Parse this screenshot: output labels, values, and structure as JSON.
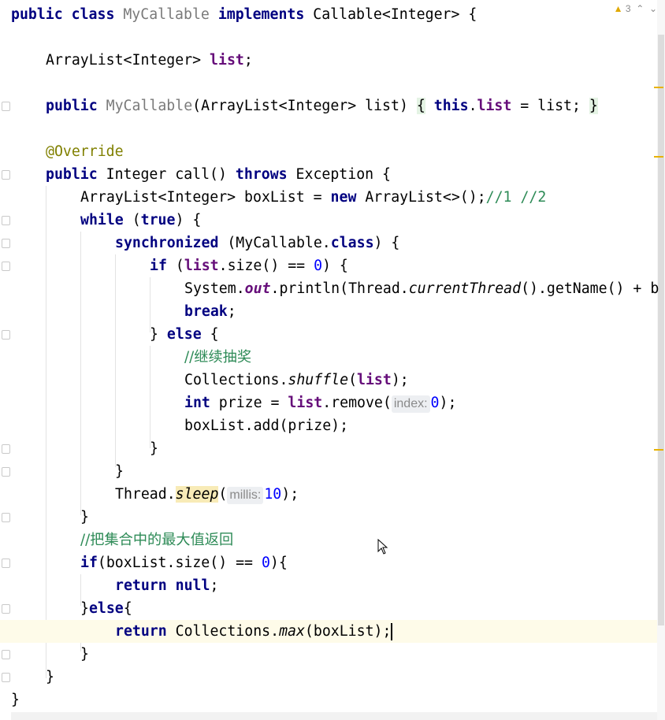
{
  "editor": {
    "warning_count": "3",
    "lines": [
      {
        "id": "l1"
      },
      {
        "id": "l2"
      }
    ],
    "code": {
      "class_decl": {
        "kw1": "public",
        "kw2": "class",
        "name": "MyCallable",
        "kw3": "implements",
        "rest": "Callable<Integer> {"
      },
      "field_decl": {
        "type": "ArrayList<Integer> ",
        "name": "list",
        ";": ";"
      },
      "ctor": {
        "kw": "public",
        "name": "MyCallable",
        "params": "(ArrayList<Integer> list) ",
        "open": "{",
        "kw2": "this",
        "dot": ".",
        "field": "list",
        "rest": " = list; ",
        "close": "}"
      },
      "annotation": "@Override",
      "method": {
        "kw1": "public",
        "mid1": " Integer call() ",
        "kw2": "throws",
        "rest": " Exception {"
      },
      "box_decl": {
        "pre": "ArrayList<Integer> boxList = ",
        "kw": "new",
        "post": " ArrayList<>();",
        "comment": "//1 //2"
      },
      "while_line": {
        "kw": "while",
        "mid": " (",
        "kw2": "true",
        "rest": ") {"
      },
      "sync_line": {
        "kw": "synchronized",
        "mid": " (MyCallable.",
        "kw2": "class",
        "rest": ") {"
      },
      "if_line": {
        "kw": "if",
        "pre": " (",
        "field": "list",
        "mid": ".size() == ",
        "num": "0",
        "rest": ") {"
      },
      "println_line": {
        "pre": "System.",
        "out": "out",
        "mid": ".println(Thread.",
        "cur": "currentThread",
        "rest": "().getName() + b"
      },
      "break_line": {
        "kw": "break",
        "rest": ";"
      },
      "else_line": {
        "pre": "} ",
        "kw": "else",
        "rest": " {"
      },
      "comment_lottery": "//继续抽奖",
      "shuffle_line": {
        "pre": "Collections.",
        "m": "shuffle",
        "open": "(",
        "field": "list",
        "rest": ");"
      },
      "remove_line": {
        "kw": "int",
        "pre": " prize = ",
        "field": "list",
        "mid": ".remove(",
        "hint": "index:",
        "num": "0",
        "rest": ");"
      },
      "add_line": "boxList.add(prize);",
      "close_if": "}",
      "close_sync": "}",
      "sleep_line": {
        "pre": "Thread.",
        "m": "sleep",
        "open": "(",
        "hint": "millis:",
        "num": "10",
        "rest": ");"
      },
      "close_while": "}",
      "comment_return": "//把集合中的最大值返回",
      "if_empty": {
        "kw": "if",
        "mid": "(boxList.size() == ",
        "num": "0",
        "rest": "){"
      },
      "return_null": {
        "kw": "return",
        "sp": " ",
        "kw2": "null",
        "rest": ";"
      },
      "else2": {
        "pre": "}",
        "kw": "else",
        "rest": "{"
      },
      "return_max": {
        "kw": "return",
        "pre": " Collections.",
        "m": "max",
        "rest": "(boxList);"
      },
      "close_else": "}",
      "close_method": "}",
      "close_class": "}"
    }
  }
}
